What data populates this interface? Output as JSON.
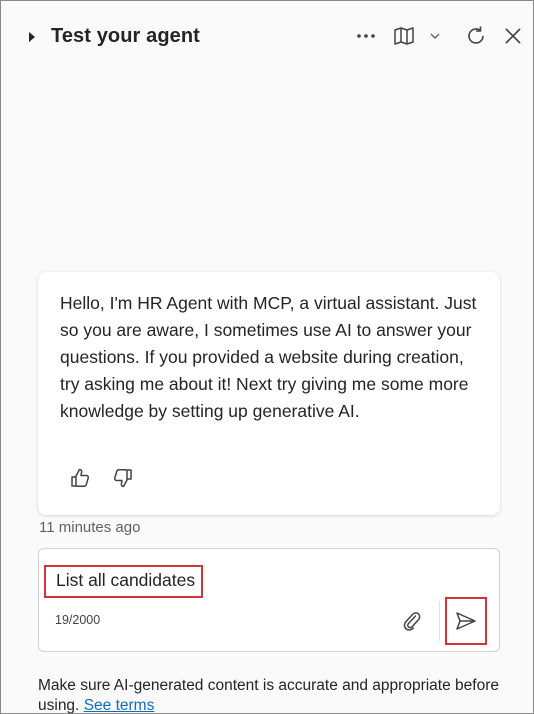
{
  "header": {
    "title": "Test your agent",
    "icons": [
      "caret-right-icon",
      "more-icon",
      "map-icon",
      "chevron-down-icon",
      "refresh-icon",
      "close-icon"
    ]
  },
  "message": {
    "text": "Hello, I'm HR Agent with MCP, a virtual assistant. Just so you are aware, I sometimes use AI to answer your questions. If you provided a website during creation, try asking me about it! Next try giving me some more knowledge by setting up generative AI.",
    "timestamp": "11 minutes ago"
  },
  "composer": {
    "value": "List all candidates",
    "char_count": "19/2000"
  },
  "footer": {
    "disclaimer": "Make sure AI-generated content is accurate and appropriate before using.",
    "link_label": "See terms"
  },
  "colors": {
    "highlight": "#d13438",
    "link": "#0f6cbd",
    "text": "#242424"
  }
}
